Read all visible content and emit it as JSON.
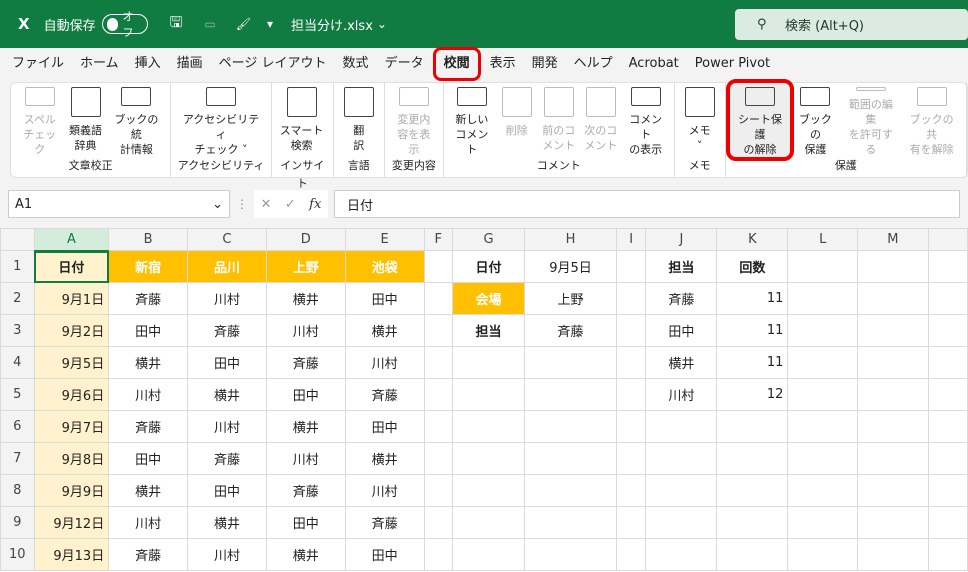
{
  "titlebar": {
    "autosave_label": "自動保存",
    "autosave_state": "オフ",
    "filename": "担当分け.xlsx",
    "search": "検索 (Alt+Q)"
  },
  "tabs": [
    "ファイル",
    "ホーム",
    "挿入",
    "描画",
    "ページ レイアウト",
    "数式",
    "データ",
    "校閲",
    "表示",
    "開発",
    "ヘルプ",
    "Acrobat",
    "Power Pivot"
  ],
  "active_tab": "校閲",
  "ribbon": [
    {
      "label": "文章校正",
      "buttons": [
        {
          "l1": "スペル",
          "l2": "チェック",
          "disabled": true
        },
        {
          "l1": "類義語",
          "l2": "辞典"
        },
        {
          "l1": "ブックの統",
          "l2": "計情報"
        }
      ]
    },
    {
      "label": "アクセシビリティ",
      "buttons": [
        {
          "l1": "アクセシビリティ",
          "l2": "チェック ˅"
        }
      ]
    },
    {
      "label": "インサイト",
      "buttons": [
        {
          "l1": "スマート",
          "l2": "検索"
        }
      ]
    },
    {
      "label": "言語",
      "buttons": [
        {
          "l1": "翻",
          "l2": "訳"
        }
      ]
    },
    {
      "label": "変更内容",
      "buttons": [
        {
          "l1": "変更内",
          "l2": "容を表示",
          "disabled": true
        }
      ]
    },
    {
      "label": "コメント",
      "buttons": [
        {
          "l1": "新しい",
          "l2": "コメント"
        },
        {
          "l1": "削除",
          "l2": "",
          "disabled": true
        },
        {
          "l1": "前のコ",
          "l2": "メント",
          "disabled": true
        },
        {
          "l1": "次のコ",
          "l2": "メント",
          "disabled": true
        },
        {
          "l1": "コメント",
          "l2": "の表示"
        }
      ]
    },
    {
      "label": "メモ",
      "buttons": [
        {
          "l1": "メモ",
          "l2": "˅"
        }
      ]
    },
    {
      "label": "保護",
      "buttons": [
        {
          "l1": "シート保護",
          "l2": "の解除",
          "highlighted": true
        },
        {
          "l1": "ブックの",
          "l2": "保護"
        },
        {
          "l1": "範囲の編集",
          "l2": "を許可する",
          "disabled": true
        },
        {
          "l1": "ブックの共",
          "l2": "有を解除",
          "disabled": true
        }
      ]
    }
  ],
  "formula_bar": {
    "name_box": "A1",
    "fx": "fx",
    "value": "日付"
  },
  "columns": [
    "A",
    "B",
    "C",
    "D",
    "E",
    "F",
    "G",
    "H",
    "I",
    "J",
    "K",
    "L",
    "M"
  ],
  "rows": [
    [
      "日付",
      "新宿",
      "品川",
      "上野",
      "池袋",
      "",
      "日付",
      "9月5日",
      "",
      "担当",
      "回数",
      "",
      ""
    ],
    [
      "9月1日",
      "斉藤",
      "川村",
      "横井",
      "田中",
      "",
      "会場",
      "上野",
      "",
      "斉藤",
      "11",
      "",
      ""
    ],
    [
      "9月2日",
      "田中",
      "斉藤",
      "川村",
      "横井",
      "",
      "担当",
      "斉藤",
      "",
      "田中",
      "11",
      "",
      ""
    ],
    [
      "9月5日",
      "横井",
      "田中",
      "斉藤",
      "川村",
      "",
      "",
      "",
      "",
      "横井",
      "11",
      "",
      ""
    ],
    [
      "9月6日",
      "川村",
      "横井",
      "田中",
      "斉藤",
      "",
      "",
      "",
      "",
      "川村",
      "12",
      "",
      ""
    ],
    [
      "9月7日",
      "斉藤",
      "川村",
      "横井",
      "田中",
      "",
      "",
      "",
      "",
      "",
      "",
      "",
      ""
    ],
    [
      "9月8日",
      "田中",
      "斉藤",
      "川村",
      "横井",
      "",
      "",
      "",
      "",
      "",
      "",
      "",
      ""
    ],
    [
      "9月9日",
      "横井",
      "田中",
      "斉藤",
      "川村",
      "",
      "",
      "",
      "",
      "",
      "",
      "",
      ""
    ],
    [
      "9月12日",
      "川村",
      "横井",
      "田中",
      "斉藤",
      "",
      "",
      "",
      "",
      "",
      "",
      "",
      ""
    ],
    [
      "9月13日",
      "斉藤",
      "川村",
      "横井",
      "田中",
      "",
      "",
      "",
      "",
      "",
      "",
      "",
      ""
    ]
  ]
}
